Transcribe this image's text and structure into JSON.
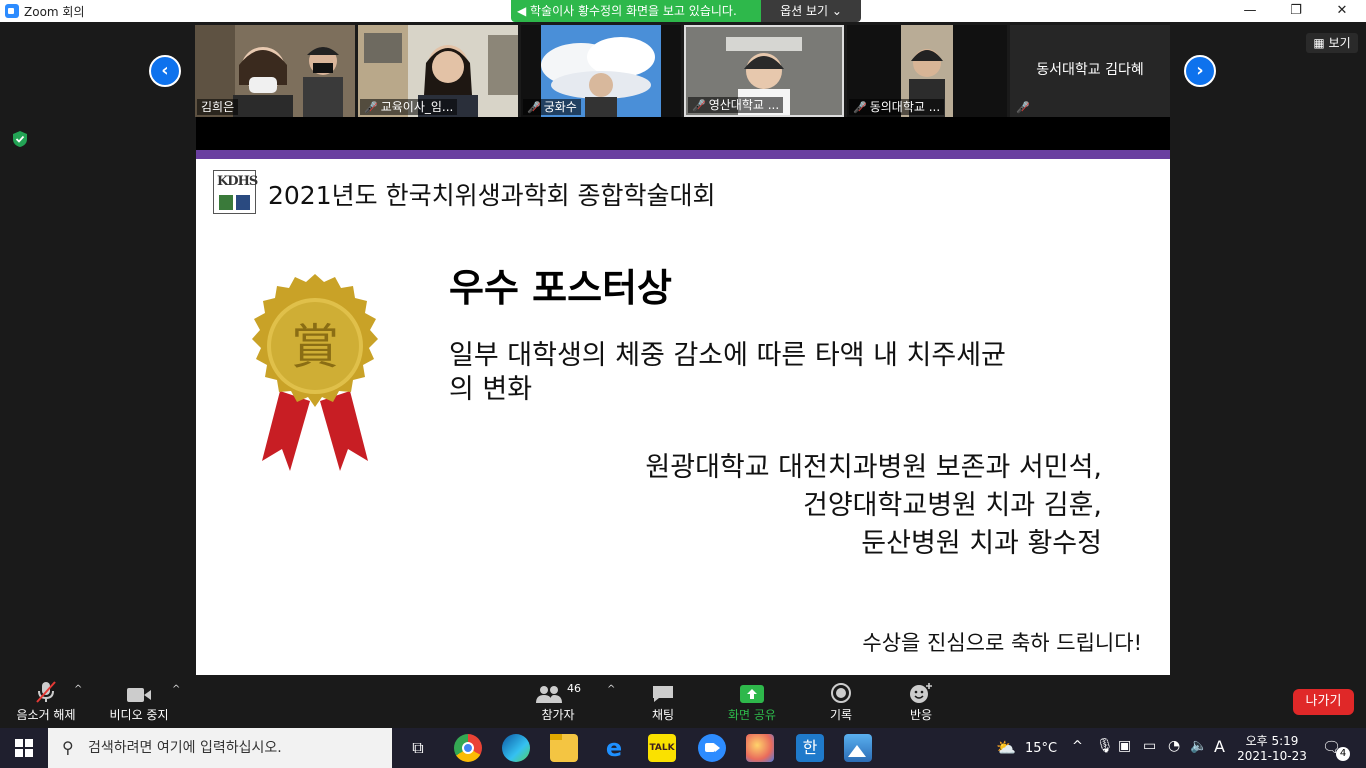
{
  "window": {
    "title": "Zoom 회의",
    "share_banner": "학술이사 황수정의 화면을 보고 있습니다.",
    "view_options": "옵션 보기 ⌄"
  },
  "participants": [
    {
      "name": "김희은",
      "muted": false
    },
    {
      "name": "교육이사_임...",
      "muted": true
    },
    {
      "name": "궁화수",
      "muted": true
    },
    {
      "name": "영산대학교 ...",
      "muted": true
    },
    {
      "name": "동의대학교 ...",
      "muted": true
    },
    {
      "name": "동서대학교 김다혜",
      "muted": true
    }
  ],
  "view_button": "보기",
  "slide": {
    "logo_text": "KDHS",
    "conference": "2021년도 한국치위생과학회 종합학술대회",
    "award": "우수 포스터상",
    "title_line1": "일부 대학생의 체중 감소에 따른 타액 내 치주세균",
    "title_line2": "의 변화",
    "author_line1": "원광대학교 대전치과병원 보존과 서민석,",
    "author_line2": "건양대학교병원 치과 김훈,",
    "author_line3": "둔산병원 치과 황수정",
    "congrats": "수상을 진심으로 축하 드립니다!",
    "medal_char": "賞"
  },
  "toolbar": {
    "unmute": "음소거 해제",
    "stop_video": "비디오 중지",
    "participants": "참가자",
    "participant_count": "46",
    "chat": "채팅",
    "share_screen": "화면 공유",
    "record": "기록",
    "reactions": "반응",
    "leave": "나가기"
  },
  "taskbar": {
    "search_placeholder": "검색하려면 여기에 입력하십시오.",
    "temperature": "15°C",
    "ime": "A",
    "time": "오후 5:19",
    "date": "2021-10-23",
    "notification_count": "4"
  },
  "colors": {
    "zoom_blue": "#0e72ed",
    "share_green": "#2eb84b",
    "leave_red": "#e02828",
    "slide_purple": "#6a3fa0"
  }
}
